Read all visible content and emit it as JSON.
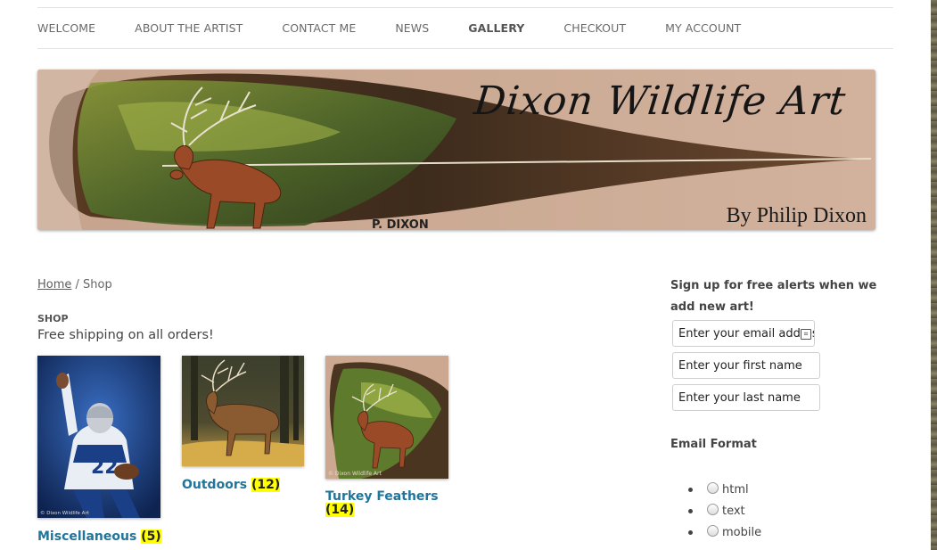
{
  "nav": {
    "items": [
      {
        "label": "WELCOME"
      },
      {
        "label": "ABOUT THE ARTIST"
      },
      {
        "label": "CONTACT ME"
      },
      {
        "label": "NEWS"
      },
      {
        "label": "GALLERY"
      },
      {
        "label": "CHECKOUT"
      },
      {
        "label": "MY ACCOUNT"
      }
    ],
    "active": "GALLERY"
  },
  "banner": {
    "title": "Dixon Wildlife Art",
    "subtitle": "By Philip Dixon",
    "signature": "P. DIXON"
  },
  "breadcrumb": {
    "home": "Home",
    "separator": " / ",
    "current": "Shop"
  },
  "shop": {
    "heading": "SHOP",
    "description": "Free shipping on all orders!",
    "categories": [
      {
        "name": "Miscellaneous",
        "count": "(5)",
        "thumb_caption": "© Dixon Wildlife Art",
        "thumb_icon": "football-player-painting"
      },
      {
        "name": "Outdoors",
        "count": "(12)",
        "thumb_icon": "elk-painting"
      },
      {
        "name": "Turkey Feathers",
        "count": "(14)",
        "thumb_caption": "© Dixon Wildlife Art",
        "thumb_icon": "deer-feather-painting"
      }
    ]
  },
  "sidebar": {
    "signup_title": "Sign up for free alerts when we add new art!",
    "email_value": "Enter your email address",
    "first_name_value": "Enter your first name",
    "last_name_value": "Enter your last name",
    "format_title": "Email Format",
    "formats": [
      "html",
      "text",
      "mobile"
    ]
  },
  "colors": {
    "link": "#21759b",
    "count_highlight": "#ffff00",
    "nav_text": "#6a6a6a",
    "page_bg": "#ffffff"
  }
}
